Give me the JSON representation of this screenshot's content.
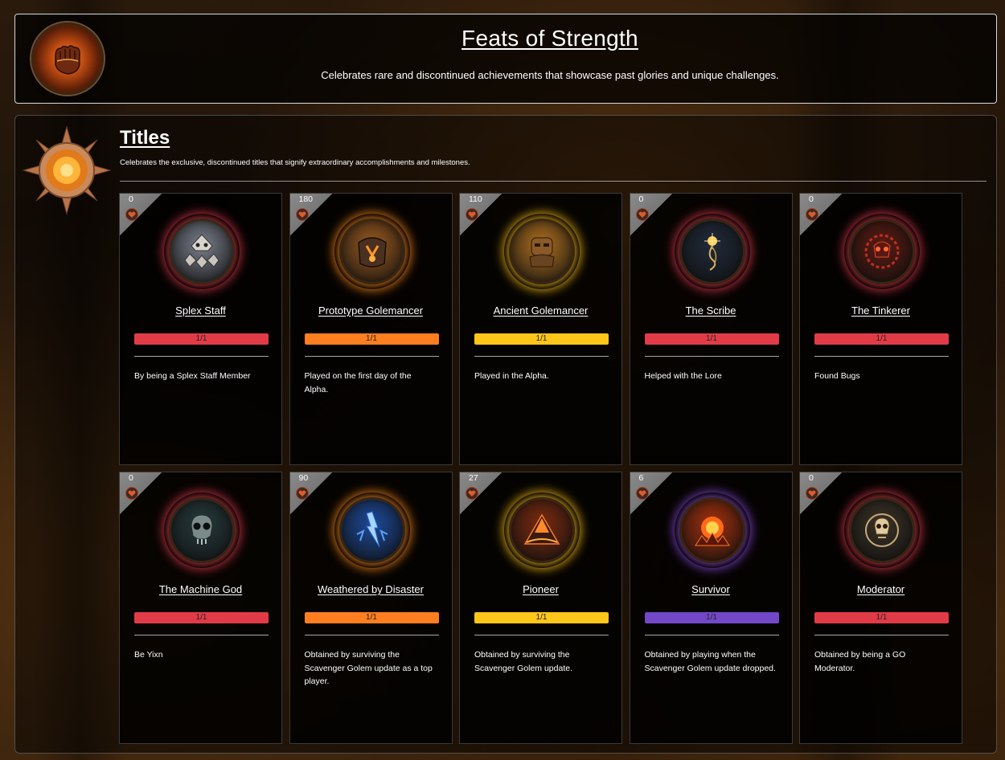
{
  "header": {
    "title": "Feats of Strength",
    "subtitle": "Celebrates rare and discontinued achievements that showcase past glories and unique challenges.",
    "emblem_icon": "flaming-fist-icon"
  },
  "section": {
    "title": "Titles",
    "subtitle": "Celebrates the exclusive, discontinued titles that signify extraordinary accomplishments and milestones.",
    "emblem_icon": "sun-medallion-icon"
  },
  "cards": [
    {
      "count": "0",
      "name": "Splex Staff",
      "progress": "1/1",
      "progress_fraction": 1,
      "color": "#e23b48",
      "glow": "#e03a50",
      "medal": "#7a7f8c",
      "icon": "skull-crest-icon",
      "desc": "By being a Splex Staff Member"
    },
    {
      "count": "180",
      "name": "Prototype Golemancer",
      "progress": "1/1",
      "progress_fraction": 1,
      "color": "#ff7e1f",
      "glow": "#ff8a1f",
      "medal": "#9a5a1e",
      "icon": "golem-armor-icon",
      "desc": "Played on the first day of the Alpha."
    },
    {
      "count": "110",
      "name": "Ancient Golemancer",
      "progress": "1/1",
      "progress_fraction": 1,
      "color": "#ffc61a",
      "glow": "#ffc21a",
      "medal": "#b0701e",
      "icon": "ancient-golem-icon",
      "desc": "Played in the Alpha."
    },
    {
      "count": "0",
      "name": "The Scribe",
      "progress": "1/1",
      "progress_fraction": 1,
      "color": "#e23b48",
      "glow": "#e03a50",
      "medal": "#1f2a3a",
      "icon": "quill-star-icon",
      "desc": "Helped with the Lore"
    },
    {
      "count": "0",
      "name": "The Tinkerer",
      "progress": "1/1",
      "progress_fraction": 1,
      "color": "#e23b48",
      "glow": "#e03a50",
      "medal": "#5a1a12",
      "icon": "gear-skull-icon",
      "desc": "Found Bugs"
    },
    {
      "count": "0",
      "name": "The Machine God",
      "progress": "1/1",
      "progress_fraction": 1,
      "color": "#e23b48",
      "glow": "#e03a50",
      "medal": "#26393c",
      "icon": "machine-skull-icon",
      "desc": "Be Yixn"
    },
    {
      "count": "90",
      "name": "Weathered by Disaster",
      "progress": "1/1",
      "progress_fraction": 1,
      "color": "#ff7e1f",
      "glow": "#ff8a1f",
      "medal": "#1c4a9a",
      "icon": "lightning-storm-icon",
      "desc": "Obtained by surviving the Scavenger Golem update as a top player."
    },
    {
      "count": "27",
      "name": "Pioneer",
      "progress": "1/1",
      "progress_fraction": 1,
      "color": "#ffc61a",
      "glow": "#ffc21a",
      "medal": "#7a2a0e",
      "icon": "volcano-peak-icon",
      "desc": "Obtained by surviving the Scavenger Golem update."
    },
    {
      "count": "6",
      "name": "Survivor",
      "progress": "1/1",
      "progress_fraction": 1,
      "color": "#7248c8",
      "glow": "#8a4adf",
      "medal": "#a3300c",
      "icon": "fiery-explosion-icon",
      "desc": "Obtained by playing when the Scavenger Golem update dropped."
    },
    {
      "count": "0",
      "name": "Moderator",
      "progress": "1/1",
      "progress_fraction": 1,
      "color": "#e23b48",
      "glow": "#e03a50",
      "medal": "#3a3226",
      "icon": "shield-skull-icon",
      "desc": "Obtained by being a GO Moderator."
    }
  ]
}
